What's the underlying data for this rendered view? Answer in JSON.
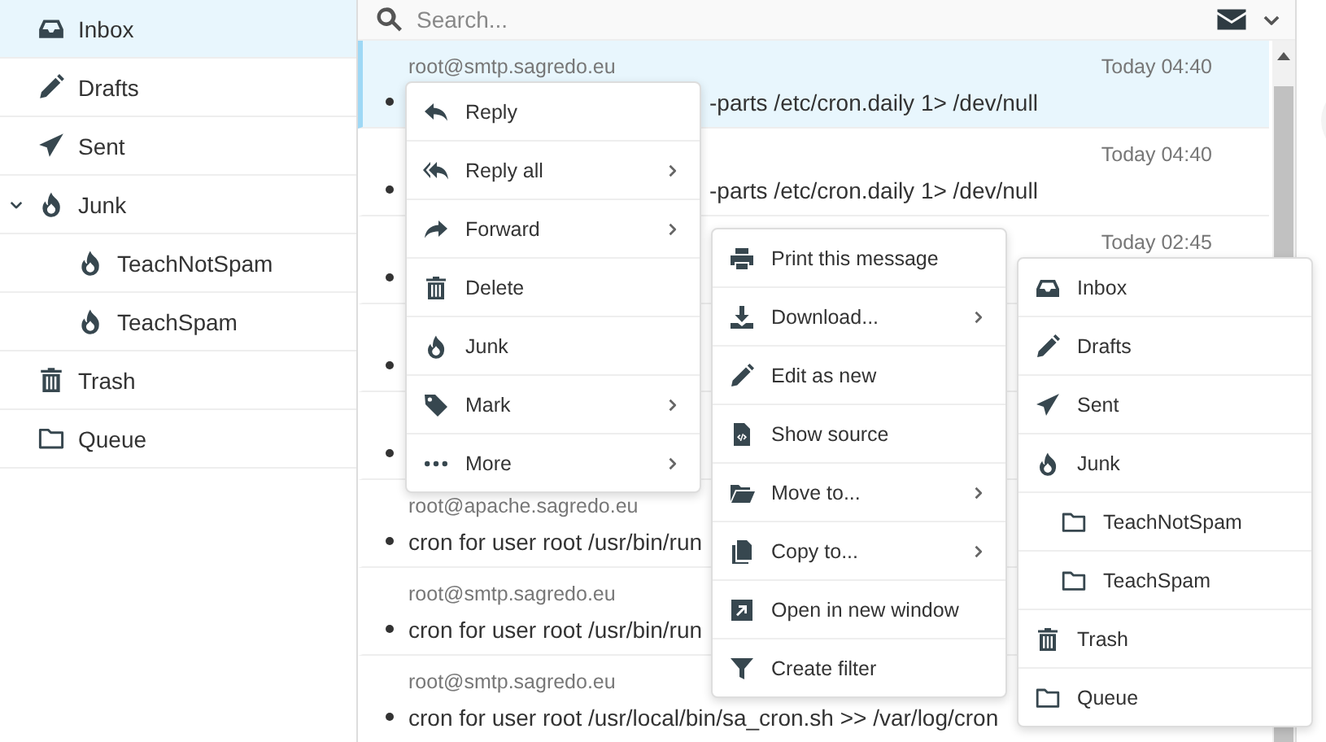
{
  "sidebar": {
    "folders": [
      {
        "label": "Inbox",
        "selected": true
      },
      {
        "label": "Drafts",
        "selected": false
      },
      {
        "label": "Sent",
        "selected": false
      },
      {
        "label": "Junk",
        "selected": false,
        "expanded": true,
        "children": [
          {
            "label": "TeachNotSpam",
            "selected": false
          },
          {
            "label": "TeachSpam",
            "selected": false
          }
        ]
      },
      {
        "label": "Trash",
        "selected": false
      },
      {
        "label": "Queue",
        "selected": false
      }
    ]
  },
  "search": {
    "placeholder": "Search..."
  },
  "messages": [
    {
      "kind": "tail",
      "sender": "root@smtp.sagredo.eu",
      "time": "Today 04:40",
      "subject": "-parts /etc/cron.daily 1> /dev/null",
      "selected": true
    },
    {
      "kind": "tail",
      "time": "Today 04:40",
      "subject": "-parts /etc/cron.daily 1> /dev/null",
      "selected": false
    },
    {
      "time": "Today 02:45",
      "selected": false
    },
    {
      "selected": false
    },
    {
      "selected": false
    },
    {
      "kind": "full",
      "sender": "root@apache.sagredo.eu",
      "subject": "cron for user root /usr/bin/run",
      "selected": false
    },
    {
      "kind": "full",
      "sender": "root@smtp.sagredo.eu",
      "subject": "cron for user root /usr/bin/run",
      "selected": false
    },
    {
      "kind": "full",
      "sender": "root@smtp.sagredo.eu",
      "subject": "cron for user root /usr/local/bin/sa_cron.sh >> /var/log/cron",
      "selected": false
    }
  ],
  "context_menu": {
    "items": [
      {
        "label": "Reply",
        "submenu": false
      },
      {
        "label": "Reply all",
        "submenu": true
      },
      {
        "label": "Forward",
        "submenu": true
      },
      {
        "label": "Delete",
        "submenu": false
      },
      {
        "label": "Junk",
        "submenu": false
      },
      {
        "label": "Mark",
        "submenu": true
      },
      {
        "label": "More",
        "submenu": true
      }
    ]
  },
  "more_menu": {
    "items": [
      {
        "label": "Print this message",
        "submenu": false
      },
      {
        "label": "Download...",
        "submenu": true
      },
      {
        "label": "Edit as new",
        "submenu": false
      },
      {
        "label": "Show source",
        "submenu": false
      },
      {
        "label": "Move to...",
        "submenu": true
      },
      {
        "label": "Copy to...",
        "submenu": true
      },
      {
        "label": "Open in new window",
        "submenu": false
      },
      {
        "label": "Create filter",
        "submenu": false
      }
    ]
  },
  "move_menu": {
    "folders": [
      {
        "label": "Inbox"
      },
      {
        "label": "Drafts"
      },
      {
        "label": "Sent"
      },
      {
        "label": "Junk",
        "children": [
          {
            "label": "TeachNotSpam"
          },
          {
            "label": "TeachSpam"
          }
        ]
      },
      {
        "label": "Trash"
      },
      {
        "label": "Queue"
      }
    ]
  }
}
